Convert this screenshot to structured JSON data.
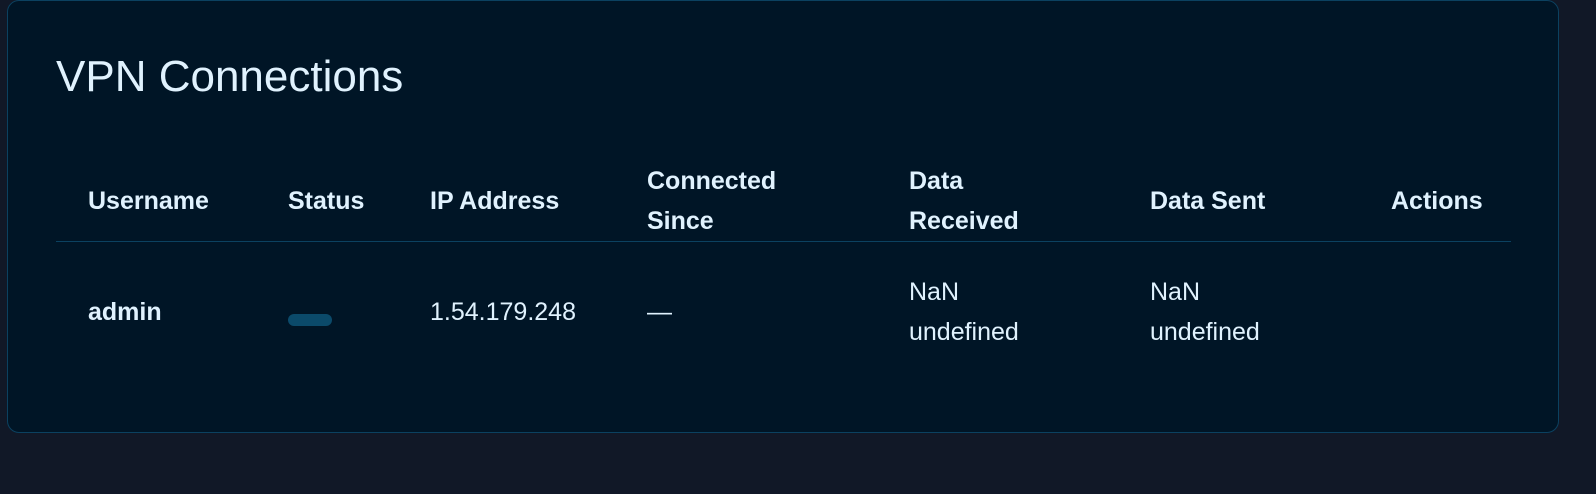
{
  "title": "VPN Connections",
  "table": {
    "headers": {
      "username": "Username",
      "status": "Status",
      "ip": "IP Address",
      "since_line1": "Connected",
      "since_line2": "Since",
      "received_line1": "Data",
      "received_line2": "Received",
      "sent": "Data Sent",
      "actions": "Actions"
    },
    "rows": [
      {
        "username": "admin",
        "status": "",
        "ip": "1.54.179.248",
        "since": "—",
        "received_value": "NaN",
        "received_unit": "undefined",
        "sent_value": "NaN",
        "sent_unit": "undefined"
      }
    ]
  },
  "colors": {
    "page_bg": "#111827",
    "card_bg": "#001526",
    "border": "#0b4160",
    "text": "#e0f2fe",
    "status_pill": "#0b4a6a"
  }
}
